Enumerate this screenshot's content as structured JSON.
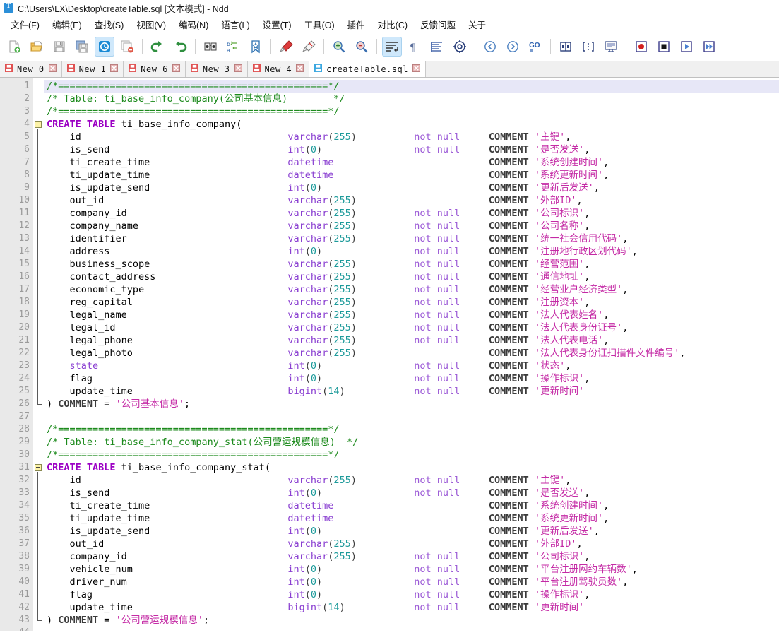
{
  "window": {
    "title": "C:\\Users\\LX\\Desktop\\createTable.sql [文本模式] - Ndd",
    "app_icon": "text-document-icon"
  },
  "menubar": {
    "items": [
      {
        "label": "文件(F)",
        "name": "menu-file"
      },
      {
        "label": "编辑(E)",
        "name": "menu-edit"
      },
      {
        "label": "查找(S)",
        "name": "menu-search"
      },
      {
        "label": "视图(V)",
        "name": "menu-view"
      },
      {
        "label": "编码(N)",
        "name": "menu-encoding"
      },
      {
        "label": "语言(L)",
        "name": "menu-language"
      },
      {
        "label": "设置(T)",
        "name": "menu-settings"
      },
      {
        "label": "工具(O)",
        "name": "menu-tools"
      },
      {
        "label": "插件",
        "name": "menu-plugins"
      },
      {
        "label": "对比(C)",
        "name": "menu-compare"
      },
      {
        "label": "反馈问题",
        "name": "menu-feedback"
      },
      {
        "label": "关于",
        "name": "menu-about"
      }
    ]
  },
  "toolbar": {
    "buttons": [
      {
        "icon": "new-file-icon"
      },
      {
        "icon": "open-folder-icon"
      },
      {
        "icon": "save-icon"
      },
      {
        "icon": "save-all-icon"
      },
      {
        "icon": "close-file-icon",
        "active": true
      },
      {
        "icon": "close-all-icon"
      },
      {
        "sep": true
      },
      {
        "icon": "undo-icon"
      },
      {
        "icon": "redo-icon"
      },
      {
        "sep": true
      },
      {
        "icon": "find-icon"
      },
      {
        "icon": "replace-icon"
      },
      {
        "icon": "bookmark-icon"
      },
      {
        "sep": true
      },
      {
        "icon": "marker-red-icon"
      },
      {
        "icon": "marker-clear-icon"
      },
      {
        "sep": true
      },
      {
        "icon": "zoom-in-icon"
      },
      {
        "icon": "zoom-out-icon"
      },
      {
        "sep": true
      },
      {
        "icon": "word-wrap-icon",
        "active": true
      },
      {
        "icon": "pilcrow-icon"
      },
      {
        "icon": "indent-guide-icon"
      },
      {
        "icon": "all-chars-icon"
      },
      {
        "sep": true
      },
      {
        "icon": "prev-icon"
      },
      {
        "icon": "next-icon"
      },
      {
        "icon": "go-to-line-icon"
      },
      {
        "sep": true
      },
      {
        "icon": "split-vertical-icon"
      },
      {
        "icon": "split-horizontal-icon"
      },
      {
        "icon": "monitor-icon"
      },
      {
        "sep": true
      },
      {
        "icon": "record-macro-icon"
      },
      {
        "icon": "stop-macro-icon"
      },
      {
        "icon": "play-macro-icon"
      },
      {
        "icon": "play-multi-macro-icon"
      }
    ]
  },
  "tabs": [
    {
      "label": "New 0",
      "active": false,
      "icon": "save-red-icon",
      "close": "close-icon"
    },
    {
      "label": "New 1",
      "active": false,
      "icon": "save-red-icon",
      "close": "close-icon"
    },
    {
      "label": "New 6",
      "active": false,
      "icon": "save-red-icon",
      "close": "close-icon"
    },
    {
      "label": "New 3",
      "active": false,
      "icon": "save-red-icon",
      "close": "close-icon"
    },
    {
      "label": "New 4",
      "active": false,
      "icon": "save-red-icon",
      "close": "close-icon"
    },
    {
      "label": "createTable.sql",
      "active": true,
      "icon": "save-blue-icon",
      "close": "close-icon"
    }
  ],
  "editor": {
    "first_line": 1,
    "total_lines": 44,
    "current_line": 1,
    "lines": [
      {
        "n": 1,
        "tokens": [
          {
            "c": "com",
            "t": "/*===============================================*/"
          }
        ]
      },
      {
        "n": 2,
        "tokens": [
          {
            "c": "com",
            "t": "/* Table: ti_base_info_company(公司基本信息)        */"
          }
        ]
      },
      {
        "n": 3,
        "tokens": [
          {
            "c": "com",
            "t": "/*===============================================*/"
          }
        ]
      },
      {
        "n": 4,
        "tokens": [
          {
            "c": "kw",
            "t": "CREATE TABLE "
          },
          {
            "c": "plain",
            "t": "ti_base_info_company("
          }
        ],
        "fold": "start"
      },
      {
        "n": 5,
        "name": "id",
        "type": "varchar",
        "len": "255",
        "nn": "not null",
        "comment": "主键",
        "tail": ","
      },
      {
        "n": 6,
        "name": "is_send",
        "type": "int",
        "len": "0",
        "nn": "not null",
        "comment": "是否发送",
        "tail": ","
      },
      {
        "n": 7,
        "name": "ti_create_time",
        "type": "datetime",
        "len": null,
        "nn": "",
        "comment": "系统创建时间",
        "tail": ","
      },
      {
        "n": 8,
        "name": "ti_update_time",
        "type": "datetime",
        "len": null,
        "nn": "",
        "comment": "系统更新时间",
        "tail": ","
      },
      {
        "n": 9,
        "name": "is_update_send",
        "type": "int",
        "len": "0",
        "nn": "",
        "comment": "更新后发送",
        "tail": ","
      },
      {
        "n": 10,
        "name": "out_id",
        "type": "varchar",
        "len": "255",
        "nn": "",
        "comment": "外部ID",
        "tail": ","
      },
      {
        "n": 11,
        "name": "company_id",
        "type": "varchar",
        "len": "255",
        "nn": "not null",
        "comment": "公司标识",
        "tail": ","
      },
      {
        "n": 12,
        "name": "company_name",
        "type": "varchar",
        "len": "255",
        "nn": "not null",
        "comment": "公司名称",
        "tail": ","
      },
      {
        "n": 13,
        "name": "identifier",
        "type": "varchar",
        "len": "255",
        "nn": "not null",
        "comment": "统一社会信用代码",
        "tail": ","
      },
      {
        "n": 14,
        "name": "address",
        "type": "int",
        "len": "0",
        "nn": "not null",
        "comment": "注册地行政区划代码",
        "tail": ","
      },
      {
        "n": 15,
        "name": "business_scope",
        "type": "varchar",
        "len": "255",
        "nn": "not null",
        "comment": "经营范围",
        "tail": ","
      },
      {
        "n": 16,
        "name": "contact_address",
        "type": "varchar",
        "len": "255",
        "nn": "not null",
        "comment": "通信地址",
        "tail": ","
      },
      {
        "n": 17,
        "name": "economic_type",
        "type": "varchar",
        "len": "255",
        "nn": "not null",
        "comment": "经营业户经济类型",
        "tail": ","
      },
      {
        "n": 18,
        "name": "reg_capital",
        "type": "varchar",
        "len": "255",
        "nn": "not null",
        "comment": "注册资本",
        "tail": ","
      },
      {
        "n": 19,
        "name": "legal_name",
        "type": "varchar",
        "len": "255",
        "nn": "not null",
        "comment": "法人代表姓名",
        "tail": ","
      },
      {
        "n": 20,
        "name": "legal_id",
        "type": "varchar",
        "len": "255",
        "nn": "not null",
        "comment": "法人代表身份证号",
        "tail": ","
      },
      {
        "n": 21,
        "name": "legal_phone",
        "type": "varchar",
        "len": "255",
        "nn": "not null",
        "comment": "法人代表电话",
        "tail": ","
      },
      {
        "n": 22,
        "name": "legal_photo",
        "type": "varchar",
        "len": "255",
        "nn": "",
        "comment": "法人代表身份证扫描件文件编号",
        "tail": ","
      },
      {
        "n": 23,
        "name": "state",
        "name_kw": true,
        "type": "int",
        "len": "0",
        "nn": "not null",
        "comment": "状态",
        "tail": ","
      },
      {
        "n": 24,
        "name": "flag",
        "type": "int",
        "len": "0",
        "nn": "not null",
        "comment": "操作标识",
        "tail": ","
      },
      {
        "n": 25,
        "name": "update_time",
        "type": "bigint",
        "len": "14",
        "nn": "not null",
        "comment": "更新时间",
        "tail": ""
      },
      {
        "n": 26,
        "close_table": true,
        "table_comment": "公司基本信息",
        "fold": "end"
      },
      {
        "n": 27,
        "tokens": []
      },
      {
        "n": 28,
        "tokens": [
          {
            "c": "com",
            "t": "/*===============================================*/"
          }
        ]
      },
      {
        "n": 29,
        "tokens": [
          {
            "c": "com",
            "t": "/* Table: ti_base_info_company_stat(公司营运规模信息)  */"
          }
        ]
      },
      {
        "n": 30,
        "tokens": [
          {
            "c": "com",
            "t": "/*===============================================*/"
          }
        ]
      },
      {
        "n": 31,
        "tokens": [
          {
            "c": "kw",
            "t": "CREATE TABLE "
          },
          {
            "c": "plain",
            "t": "ti_base_info_company_stat("
          }
        ],
        "fold": "start"
      },
      {
        "n": 32,
        "name": "id",
        "type": "varchar",
        "len": "255",
        "nn": "not null",
        "comment": "主键",
        "tail": ","
      },
      {
        "n": 33,
        "name": "is_send",
        "type": "int",
        "len": "0",
        "nn": "not null",
        "comment": "是否发送",
        "tail": ","
      },
      {
        "n": 34,
        "name": "ti_create_time",
        "type": "datetime",
        "len": null,
        "nn": "",
        "comment": "系统创建时间",
        "tail": ","
      },
      {
        "n": 35,
        "name": "ti_update_time",
        "type": "datetime",
        "len": null,
        "nn": "",
        "comment": "系统更新时间",
        "tail": ","
      },
      {
        "n": 36,
        "name": "is_update_send",
        "type": "int",
        "len": "0",
        "nn": "",
        "comment": "更新后发送",
        "tail": ","
      },
      {
        "n": 37,
        "name": "out_id",
        "type": "varchar",
        "len": "255",
        "nn": "",
        "comment": "外部ID",
        "tail": ","
      },
      {
        "n": 38,
        "name": "company_id",
        "type": "varchar",
        "len": "255",
        "nn": "not null",
        "comment": "公司标识",
        "tail": ","
      },
      {
        "n": 39,
        "name": "vehicle_num",
        "type": "int",
        "len": "0",
        "nn": "not null",
        "comment": "平台注册网约车辆数",
        "tail": ","
      },
      {
        "n": 40,
        "name": "driver_num",
        "type": "int",
        "len": "0",
        "nn": "not null",
        "comment": "平台注册驾驶员数",
        "tail": ","
      },
      {
        "n": 41,
        "name": "flag",
        "type": "int",
        "len": "0",
        "nn": "not null",
        "comment": "操作标识",
        "tail": ","
      },
      {
        "n": 42,
        "name": "update_time",
        "type": "bigint",
        "len": "14",
        "nn": "not null",
        "comment": "更新时间",
        "tail": ""
      },
      {
        "n": 43,
        "close_table": true,
        "table_comment": "公司营运规模信息",
        "fold": "end"
      },
      {
        "n": 44,
        "tokens": []
      }
    ],
    "labels": {
      "comment_keyword": "COMMENT",
      "equals": "=",
      "close_paren": ")",
      "semicolon": ";",
      "quote": "'"
    }
  },
  "colors": {
    "comment_green": "#1c8a1c",
    "keyword_purple": "#9b00c4",
    "type_violet": "#8a3fd1",
    "number_teal": "#1c9a9a",
    "string_magenta": "#c42aa5",
    "notnull_violet": "#9b59d6",
    "current_line_bg": "#e7e7f7",
    "gutter_bg": "#e9e9e9",
    "tab_active_bg": "#ffffff"
  }
}
